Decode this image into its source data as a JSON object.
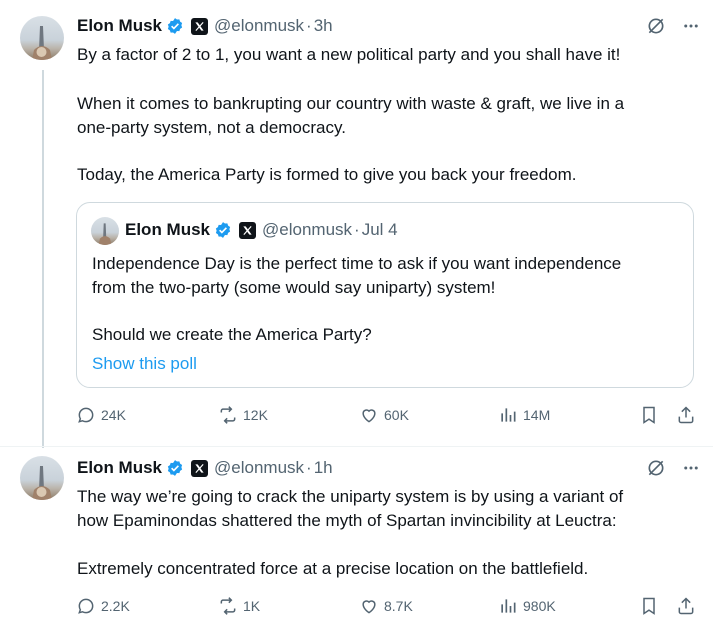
{
  "tweet1": {
    "name": "Elon Musk",
    "handle": "@elonmusk",
    "separator": "·",
    "time": "3h",
    "lines": [
      "By a factor of 2 to 1, you want a new political party and you shall have it!",
      "When it comes to bankrupting our country with waste & graft, we live in a",
      "one-party system, not a democracy.",
      "Today, the America Party is formed to give you back your freedom."
    ],
    "quote": {
      "name": "Elon Musk",
      "handle": "@elonmusk",
      "separator": "·",
      "time": "Jul 4",
      "lines": [
        "Independence Day is the perfect time to ask if you want independence",
        "from the two-party (some would say uniparty) system!",
        "Should we create the America Party?"
      ],
      "link": "Show this poll"
    },
    "stats": {
      "replies": "24K",
      "reposts": "12K",
      "likes": "60K",
      "views": "14M"
    }
  },
  "tweet2": {
    "name": "Elon Musk",
    "handle": "@elonmusk",
    "separator": "·",
    "time": "1h",
    "lines": [
      "The way we’re going to crack the uniparty system is by using a variant of",
      "how Epaminondas shattered the myth of Spartan invincibility at Leuctra:",
      "Extremely concentrated force at a precise location on the battlefield."
    ],
    "stats": {
      "replies": "2.2K",
      "reposts": "1K",
      "likes": "8.7K",
      "views": "980K"
    }
  },
  "colors": {
    "text": "#0f1419",
    "secondary": "#536471",
    "accent": "#1d9bf0",
    "border": "#cfd9de"
  },
  "icons": [
    "verified-icon",
    "x-logo-icon",
    "grok-icon",
    "more-icon",
    "reply-icon",
    "repost-icon",
    "like-icon",
    "views-icon",
    "bookmark-icon",
    "share-icon"
  ]
}
